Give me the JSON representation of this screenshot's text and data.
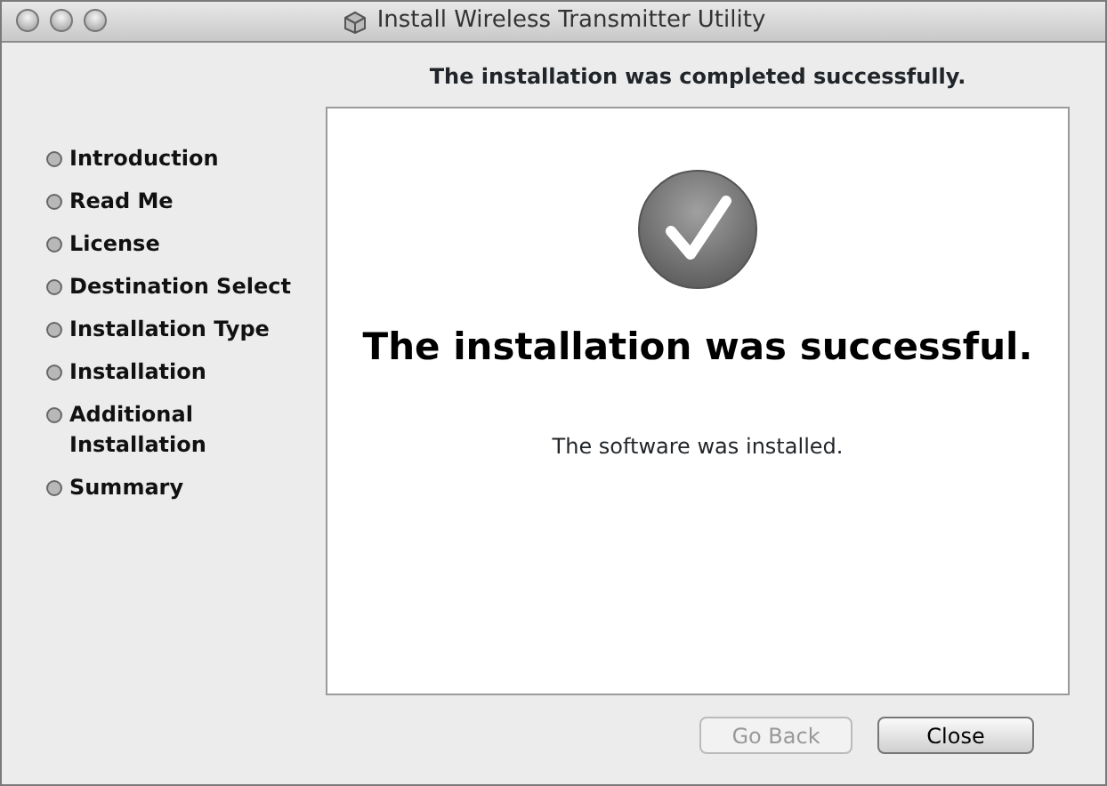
{
  "window": {
    "title": "Install Wireless Transmitter Utility"
  },
  "header": "The installation was completed successfully.",
  "steps": [
    {
      "label": "Introduction"
    },
    {
      "label": "Read Me"
    },
    {
      "label": "License"
    },
    {
      "label": "Destination Select"
    },
    {
      "label": "Installation Type"
    },
    {
      "label": "Installation"
    },
    {
      "label": "Additional Installation"
    },
    {
      "label": "Summary"
    }
  ],
  "panel": {
    "heading": "The installation was successful.",
    "message": "The software was installed."
  },
  "buttons": [
    {
      "label": "Go Back",
      "disabled": true
    },
    {
      "label": "Close",
      "disabled": false
    }
  ]
}
